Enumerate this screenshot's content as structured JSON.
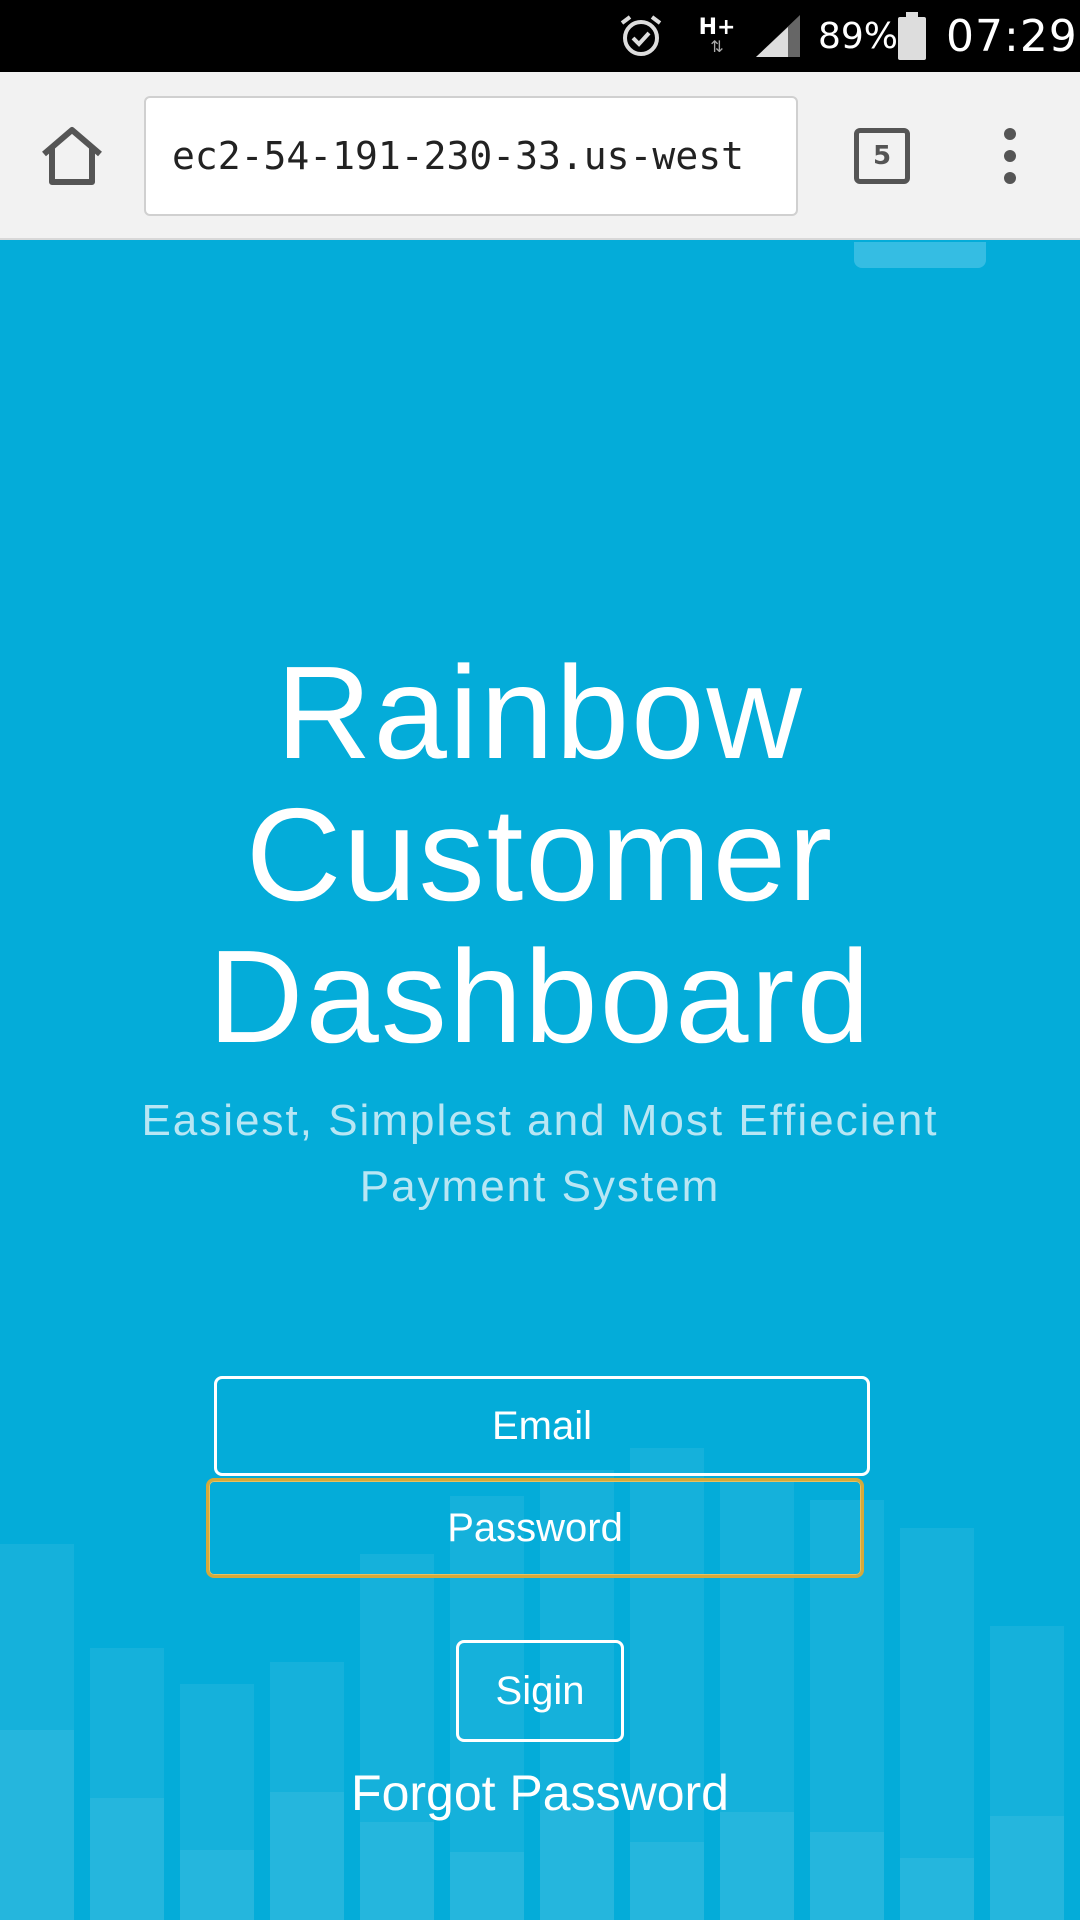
{
  "status_bar": {
    "battery_percent": "89%",
    "time": "07:29",
    "network_type": "H+",
    "icons": [
      "alarm-icon",
      "network-arrows-icon",
      "signal-icon",
      "battery-icon"
    ]
  },
  "browser": {
    "url": "ec2-54-191-230-33.us-west",
    "tab_count": "5",
    "icons": [
      "home-icon",
      "tabs-icon",
      "overflow-menu-icon"
    ]
  },
  "hero": {
    "title_lines": [
      "Rainbow",
      "Customer",
      "Dashboard"
    ],
    "subtitle": "Easiest, Simplest and Most Effiecient Payment System"
  },
  "login_form": {
    "email_placeholder": "Email",
    "password_placeholder": "Password",
    "signin_label": "Sigin",
    "forgot_label": "Forgot Password"
  },
  "colors": {
    "background": "#04acd9",
    "toolbar": "#f2f2f2",
    "text": "#ffffff",
    "subtitle": "#b8e6f4",
    "focus_border": "#d6a93a"
  }
}
